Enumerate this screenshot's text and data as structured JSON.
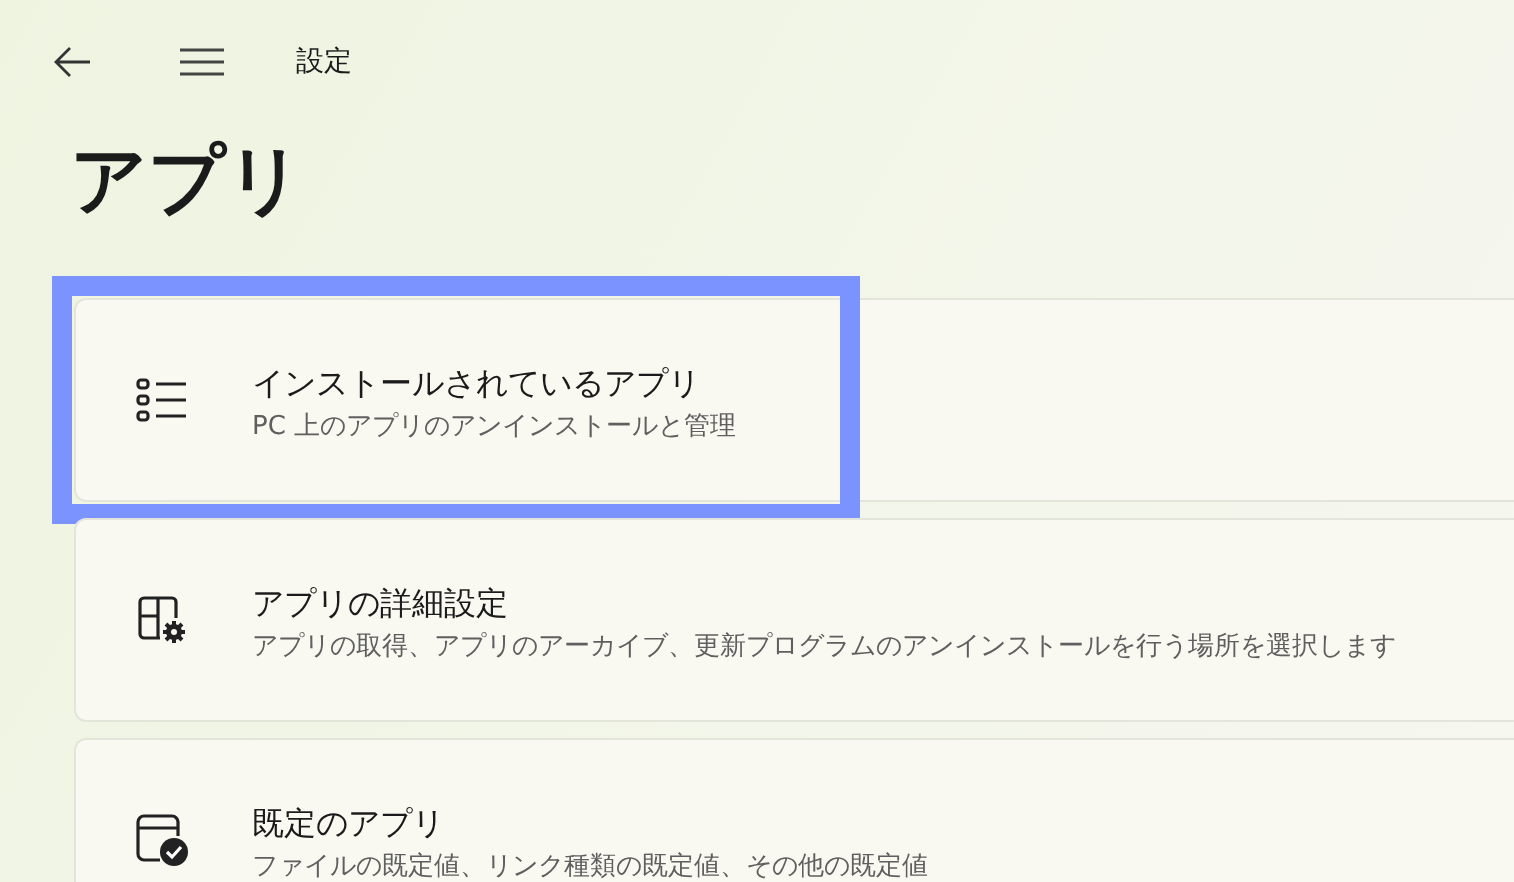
{
  "header": {
    "title": "設定"
  },
  "page_title": "アプリ",
  "items": [
    {
      "kind": "installed",
      "title": "インストールされているアプリ",
      "description": "PC 上のアプリのアンインストールと管理",
      "highlighted": true
    },
    {
      "kind": "advanced",
      "title": "アプリの詳細設定",
      "description": "アプリの取得、アプリのアーカイブ、更新プログラムのアンインストールを行う場所を選択します",
      "highlighted": false
    },
    {
      "kind": "defaults",
      "title": "既定のアプリ",
      "description": "ファイルの既定値、リンク種類の既定値、その他の既定値",
      "highlighted": false
    }
  ]
}
